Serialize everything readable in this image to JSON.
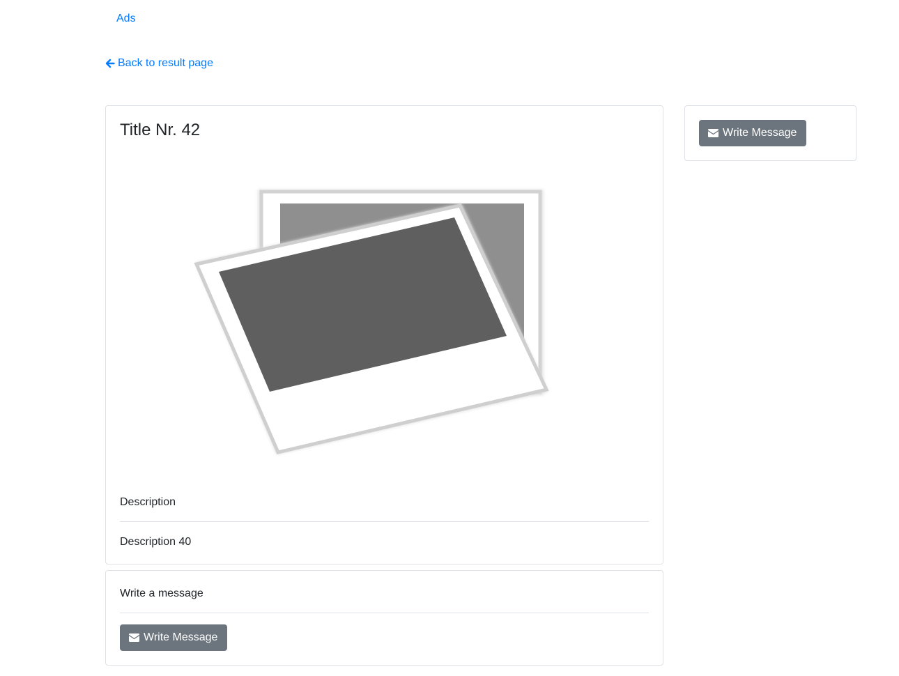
{
  "nav": {
    "ads_label": "Ads"
  },
  "back": {
    "label": "Back to result page",
    "icon": "arrow-left-icon"
  },
  "ad": {
    "title": "Title Nr. 42",
    "image_icon": "image-placeholder-icon",
    "description_label": "Description",
    "description_value": "Description 40"
  },
  "sidebar": {
    "write_message_label": "Write Message",
    "icon": "envelope-icon"
  },
  "message_section": {
    "label": "Write a message",
    "write_message_label": "Write Message",
    "icon": "envelope-icon"
  },
  "colors": {
    "link": "#007bff",
    "button_secondary": "#6c757d",
    "border": "#dee2e6"
  }
}
